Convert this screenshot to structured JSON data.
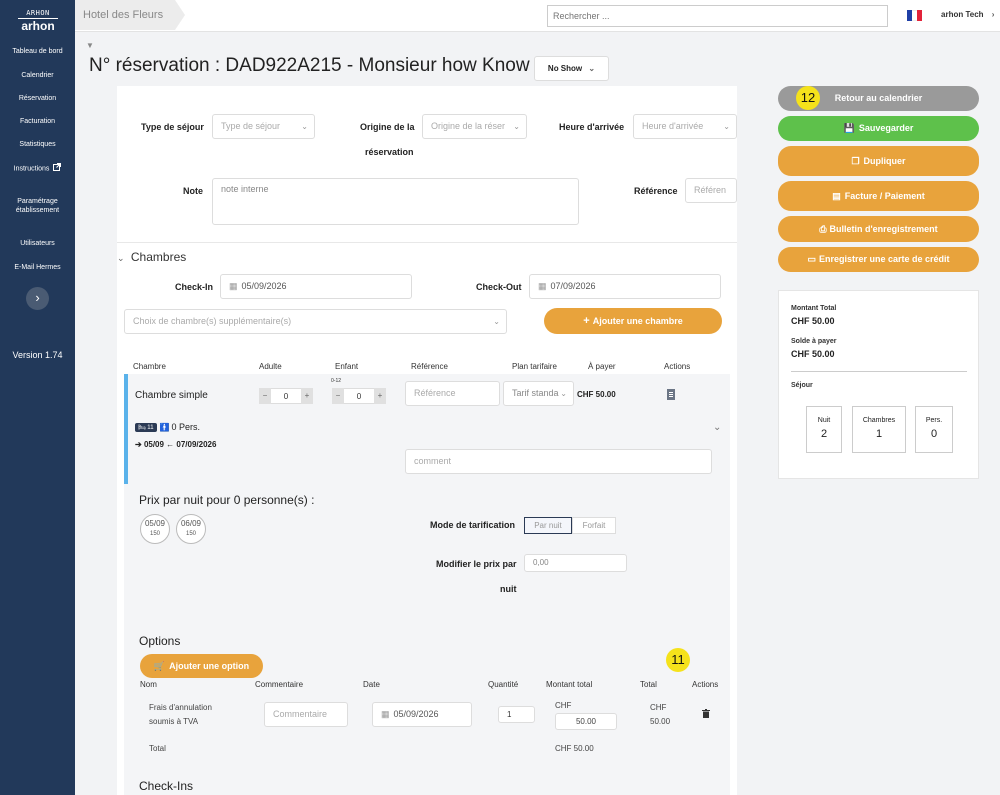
{
  "sidebar": {
    "logo_top": "ARHON",
    "logo_text": "arhon",
    "items": [
      {
        "label": "Tableau de bord"
      },
      {
        "label": "Calendrier"
      },
      {
        "label": "Réservation"
      },
      {
        "label": "Facturation"
      },
      {
        "label": "Statistiques"
      },
      {
        "label": "Instructions"
      },
      {
        "label": "Paramétrage établissement"
      },
      {
        "label": "Utilisateurs"
      },
      {
        "label": "E-Mail Hermes"
      }
    ],
    "collapse_icon": "›",
    "version": "Version 1.74"
  },
  "topbar": {
    "hotel": "Hotel des Fleurs",
    "search_placeholder": "Rechercher ...",
    "language": "fr",
    "user": "arhon Tech",
    "flag_colors": [
      "#1f3fa6",
      "#ffffff",
      "#e2233a"
    ]
  },
  "header": {
    "title": "N° réservation : DAD922A215 - Monsieur how Know",
    "status": "No Show"
  },
  "form": {
    "type_sejour_label": "Type de séjour",
    "type_sejour_placeholder": "Type de séjour",
    "origine_label_1": "Origine de la",
    "origine_label_2": "réservation",
    "origine_placeholder": "Origine de la réser",
    "heure_label": "Heure d'arrivée",
    "heure_placeholder": "Heure d'arrivée",
    "note_label": "Note",
    "note_placeholder": "note interne",
    "reference_label": "Référence",
    "reference_placeholder": "Référen"
  },
  "chambres": {
    "section_title": "Chambres",
    "checkin_label": "Check-In",
    "checkin_value": "05/09/2026",
    "checkout_label": "Check-Out",
    "checkout_value": "07/09/2026",
    "room_choice_placeholder": "Choix de chambre(s) supplémentaire(s)",
    "add_room_button": "Ajouter une chambre",
    "columns": [
      "Chambre",
      "Adulte",
      "Enfant",
      "Référence",
      "Plan tarifaire",
      "À payer",
      "Actions"
    ],
    "room": {
      "name": "Chambre simple",
      "adults": "0",
      "children": "0",
      "children_age": "0-12",
      "reference_placeholder": "Référence",
      "plan": "Tarif standa",
      "to_pay": "CHF 50.00",
      "room_badge": "11",
      "persons": "0 Pers.",
      "dates": "05/09 ← 07/09/2026",
      "comment_placeholder": "comment"
    },
    "prices_title": "Prix par nuit pour 0 personne(s) :",
    "nights": [
      {
        "date": "05/09",
        "price": "150"
      },
      {
        "date": "06/09",
        "price": "150"
      }
    ],
    "mode_label": "Mode de tarification",
    "mode_options": [
      "Par nuit",
      "Forfait"
    ],
    "mode_selected": "Par nuit",
    "modify_label_1": "Modifier le prix par",
    "modify_label_2": "nuit",
    "modify_value": "0,00"
  },
  "options": {
    "section_title": "Options",
    "add_button": "Ajouter une option",
    "columns": [
      "Nom",
      "Commentaire",
      "Date",
      "Quantité",
      "Montant total",
      "Total",
      "Actions"
    ],
    "rows": [
      {
        "name_1": "Frais d'annulation",
        "name_2": "soumis à TVA",
        "comment_placeholder": "Commentaire",
        "date": "05/09/2026",
        "quantity": "1",
        "amount_currency": "CHF",
        "amount": "50.00",
        "total_currency": "CHF",
        "total": "50.00"
      }
    ],
    "total_label": "Total",
    "total_value": "CHF 50.00"
  },
  "checkins": {
    "section_title": "Check-Ins"
  },
  "right_panel": {
    "buttons": [
      {
        "label": "Retour au calendrier",
        "color": "#9a9a9a"
      },
      {
        "label": "Sauvegarder",
        "color": "#5ec14b",
        "icon": "save-icon"
      },
      {
        "label": "Dupliquer",
        "color": "#e8a33c",
        "icon": "copy-icon"
      },
      {
        "label": "Facture / Paiement",
        "color": "#e8a33c",
        "icon": "file-icon"
      },
      {
        "label": "Bulletin d'enregistrement",
        "color": "#e8a33c",
        "icon": "print-icon"
      },
      {
        "label": "Enregistrer une carte de crédit",
        "color": "#e8a33c",
        "icon": "credit-card-icon"
      }
    ],
    "summary": {
      "montant_total_label": "Montant Total",
      "montant_total_value": "CHF 50.00",
      "solde_label": "Solde à payer",
      "solde_value": "CHF 50.00",
      "sejour_label": "Séjour",
      "stats": [
        {
          "label": "Nuit",
          "value": "2"
        },
        {
          "label": "Chambres",
          "value": "1"
        },
        {
          "label": "Pers.",
          "value": "0"
        }
      ]
    }
  },
  "annotations": {
    "badge_12": "12",
    "badge_11": "11"
  }
}
